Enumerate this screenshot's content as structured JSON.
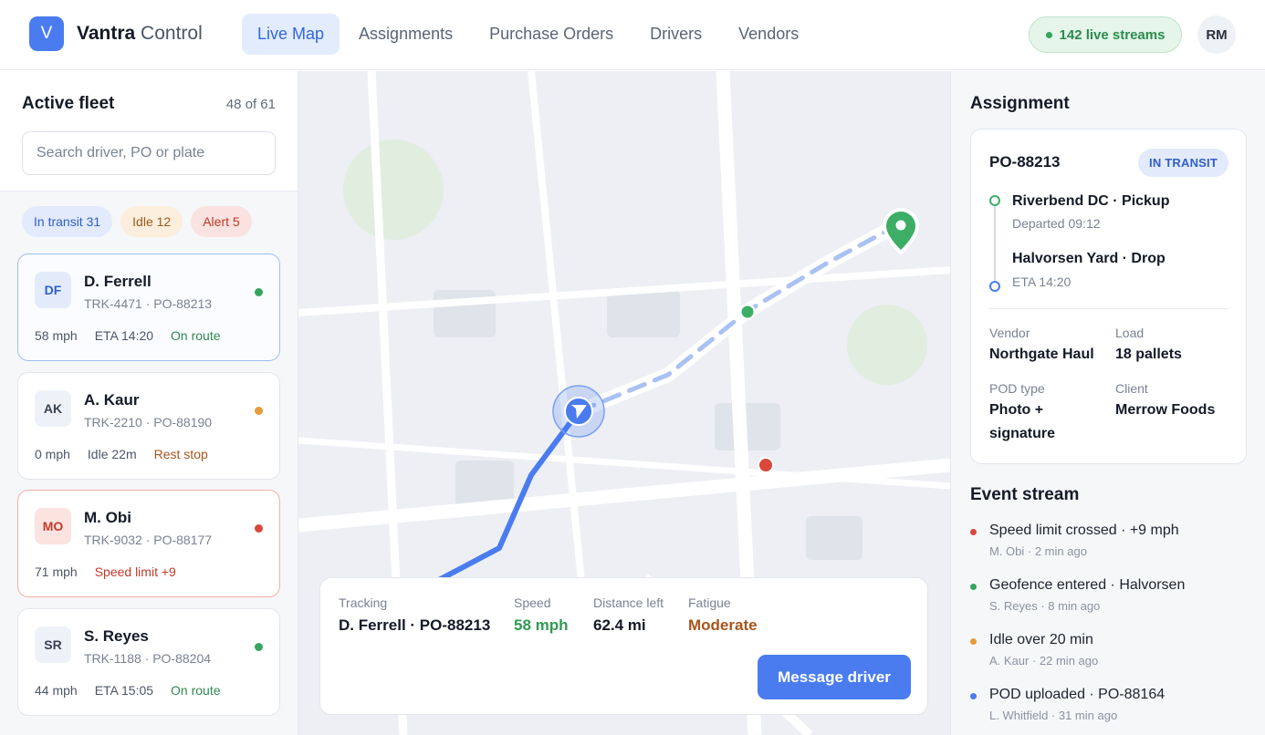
{
  "app": {
    "logo_letter": "V",
    "brand_bold": "Vantra",
    "brand_light": "Control",
    "accent_color": "#4a7cf0"
  },
  "nav": {
    "items": [
      {
        "label": "Live Map",
        "active": true
      },
      {
        "label": "Assignments",
        "active": false
      },
      {
        "label": "Purchase Orders",
        "active": false
      },
      {
        "label": "Drivers",
        "active": false
      },
      {
        "label": "Vendors",
        "active": false
      }
    ]
  },
  "header": {
    "live_streams": "142 live streams",
    "user_initials": "RM"
  },
  "fleet": {
    "title": "Active fleet",
    "count": "48 of 61",
    "search_placeholder": "Search driver, PO or plate",
    "search_value": "",
    "filters": [
      {
        "label": "In transit 31",
        "tone": "blue"
      },
      {
        "label": "Idle 12",
        "tone": "amber"
      },
      {
        "label": "Alert 5",
        "tone": "red"
      }
    ],
    "drivers": [
      {
        "initials": "DF",
        "name": "D. Ferrell",
        "sub": "TRK-4471 · PO-88213",
        "speed": "58 mph",
        "eta": "ETA 14:20",
        "status": "On route",
        "status_color": "#35a45e",
        "selected": true
      },
      {
        "initials": "AK",
        "name": "A. Kaur",
        "sub": "TRK-2210 · PO-88190",
        "speed": "0 mph",
        "eta": "Idle 22m",
        "status": "Rest stop",
        "status_color": "#e89a3c",
        "selected": false
      },
      {
        "initials": "MO",
        "name": "M. Obi",
        "sub": "TRK-9032 · PO-88177",
        "speed": "71 mph",
        "eta": "",
        "status": "Speed limit +9",
        "status_color": "#d9483b",
        "selected": false
      },
      {
        "initials": "SR",
        "name": "S. Reyes",
        "sub": "TRK-1188 · PO-88204",
        "speed": "44 mph",
        "eta": "ETA 15:05",
        "status": "On route",
        "status_color": "#35a45e",
        "selected": false
      }
    ]
  },
  "tracking": {
    "label": "Tracking",
    "value": "D. Ferrell · PO-88213",
    "speed_label": "Speed",
    "speed_value": "58 mph",
    "distance_label": "Distance left",
    "distance_value": "62.4 mi",
    "fatigue_label": "Fatigue",
    "fatigue_value": "Moderate",
    "button_label": "Message driver"
  },
  "assignment": {
    "title": "Assignment",
    "po": "PO-88213",
    "status": "IN TRANSIT",
    "pickup_name": "Riverbend DC · Pickup",
    "pickup_time": "Departed 09:12",
    "drop_name": "Halvorsen Yard · Drop",
    "drop_time": "ETA 14:20",
    "vendor_label": "Vendor",
    "vendor_value": "Northgate Haul",
    "load_label": "Load",
    "load_value": "18 pallets",
    "pod_label": "POD type",
    "pod_value_line1": "Photo +",
    "pod_value_line2": "signature",
    "client_label": "Client",
    "client_value": "Merrow Foods"
  },
  "events": {
    "title": "Event stream",
    "items": [
      {
        "title": "Speed limit crossed · +9 mph",
        "sub": "M. Obi · 2 min ago",
        "color": "#d9483b"
      },
      {
        "title": "Geofence entered · Halvorsen",
        "sub": "S. Reyes · 8 min ago",
        "color": "#35a45e"
      },
      {
        "title": "Idle over 20 min",
        "sub": "A. Kaur · 22 min ago",
        "color": "#e89a3c"
      },
      {
        "title": "POD uploaded · PO-88164",
        "sub": "L. Whitfield · 31 min ago",
        "color": "#4a7cf0"
      }
    ]
  }
}
